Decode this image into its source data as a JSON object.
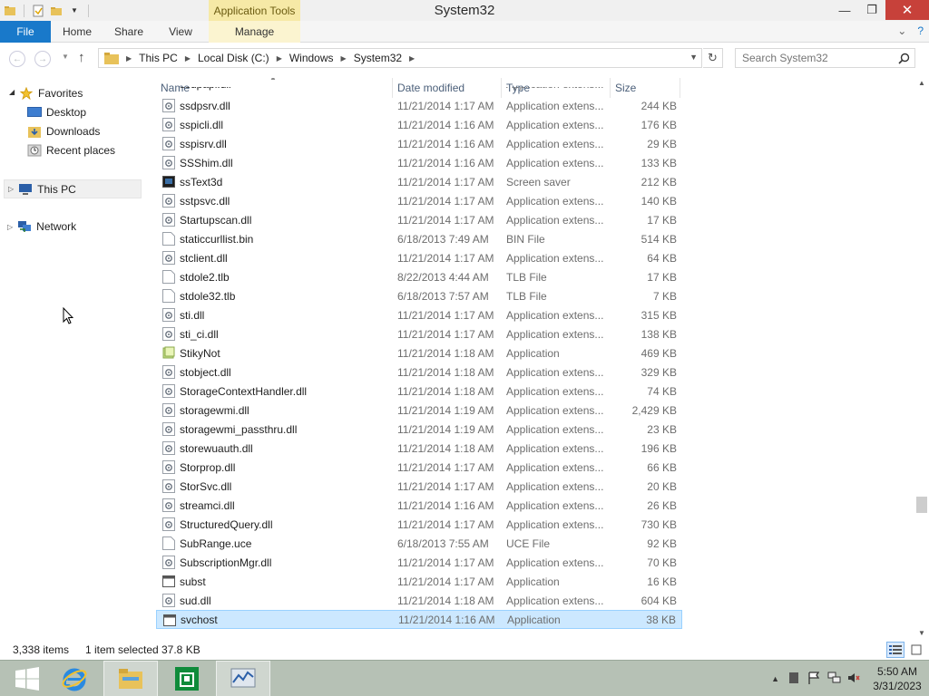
{
  "window": {
    "title": "System32",
    "contextual_tab": "Application Tools",
    "minimize": "—",
    "maximize": "❐",
    "close": "✕"
  },
  "ribbon": {
    "tabs": [
      "File",
      "Home",
      "Share",
      "View",
      "Manage"
    ],
    "expand": "⌄",
    "help": "?"
  },
  "address": {
    "crumbs": [
      "This PC",
      "Local Disk (C:)",
      "Windows",
      "System32"
    ],
    "search_placeholder": "Search System32"
  },
  "navpane": {
    "favorites": "Favorites",
    "desktop": "Desktop",
    "downloads": "Downloads",
    "recent": "Recent places",
    "this_pc": "This PC",
    "network": "Network"
  },
  "columns": {
    "name": "Name",
    "date": "Date modified",
    "type": "Type",
    "size": "Size"
  },
  "files": [
    {
      "name": "ssdpsrv.dll",
      "date": "11/21/2014 1:17 AM",
      "type": "Application extens...",
      "size": "244 KB",
      "icon": "dll"
    },
    {
      "name": "sspicli.dll",
      "date": "11/21/2014 1:16 AM",
      "type": "Application extens...",
      "size": "176 KB",
      "icon": "dll"
    },
    {
      "name": "sspisrv.dll",
      "date": "11/21/2014 1:16 AM",
      "type": "Application extens...",
      "size": "29 KB",
      "icon": "dll"
    },
    {
      "name": "SSShim.dll",
      "date": "11/21/2014 1:16 AM",
      "type": "Application extens...",
      "size": "133 KB",
      "icon": "dll"
    },
    {
      "name": "ssText3d",
      "date": "11/21/2014 1:17 AM",
      "type": "Screen saver",
      "size": "212 KB",
      "icon": "screensaver"
    },
    {
      "name": "sstpsvc.dll",
      "date": "11/21/2014 1:17 AM",
      "type": "Application extens...",
      "size": "140 KB",
      "icon": "dll"
    },
    {
      "name": "Startupscan.dll",
      "date": "11/21/2014 1:17 AM",
      "type": "Application extens...",
      "size": "17 KB",
      "icon": "dll"
    },
    {
      "name": "staticcurllist.bin",
      "date": "6/18/2013 7:49 AM",
      "type": "BIN File",
      "size": "514 KB",
      "icon": "blank"
    },
    {
      "name": "stclient.dll",
      "date": "11/21/2014 1:17 AM",
      "type": "Application extens...",
      "size": "64 KB",
      "icon": "dll"
    },
    {
      "name": "stdole2.tlb",
      "date": "8/22/2013 4:44 AM",
      "type": "TLB File",
      "size": "17 KB",
      "icon": "blank"
    },
    {
      "name": "stdole32.tlb",
      "date": "6/18/2013 7:57 AM",
      "type": "TLB File",
      "size": "7 KB",
      "icon": "blank"
    },
    {
      "name": "sti.dll",
      "date": "11/21/2014 1:17 AM",
      "type": "Application extens...",
      "size": "315 KB",
      "icon": "dll"
    },
    {
      "name": "sti_ci.dll",
      "date": "11/21/2014 1:17 AM",
      "type": "Application extens...",
      "size": "138 KB",
      "icon": "dll"
    },
    {
      "name": "StikyNot",
      "date": "11/21/2014 1:18 AM",
      "type": "Application",
      "size": "469 KB",
      "icon": "stikynot"
    },
    {
      "name": "stobject.dll",
      "date": "11/21/2014 1:18 AM",
      "type": "Application extens...",
      "size": "329 KB",
      "icon": "dll"
    },
    {
      "name": "StorageContextHandler.dll",
      "date": "11/21/2014 1:18 AM",
      "type": "Application extens...",
      "size": "74 KB",
      "icon": "dll"
    },
    {
      "name": "storagewmi.dll",
      "date": "11/21/2014 1:19 AM",
      "type": "Application extens...",
      "size": "2,429 KB",
      "icon": "dll"
    },
    {
      "name": "storagewmi_passthru.dll",
      "date": "11/21/2014 1:19 AM",
      "type": "Application extens...",
      "size": "23 KB",
      "icon": "dll"
    },
    {
      "name": "storewuauth.dll",
      "date": "11/21/2014 1:18 AM",
      "type": "Application extens...",
      "size": "196 KB",
      "icon": "dll"
    },
    {
      "name": "Storprop.dll",
      "date": "11/21/2014 1:17 AM",
      "type": "Application extens...",
      "size": "66 KB",
      "icon": "dll"
    },
    {
      "name": "StorSvc.dll",
      "date": "11/21/2014 1:17 AM",
      "type": "Application extens...",
      "size": "20 KB",
      "icon": "dll"
    },
    {
      "name": "streamci.dll",
      "date": "11/21/2014 1:16 AM",
      "type": "Application extens...",
      "size": "26 KB",
      "icon": "dll"
    },
    {
      "name": "StructuredQuery.dll",
      "date": "11/21/2014 1:17 AM",
      "type": "Application extens...",
      "size": "730 KB",
      "icon": "dll"
    },
    {
      "name": "SubRange.uce",
      "date": "6/18/2013 7:55 AM",
      "type": "UCE File",
      "size": "92 KB",
      "icon": "blank"
    },
    {
      "name": "SubscriptionMgr.dll",
      "date": "11/21/2014 1:17 AM",
      "type": "Application extens...",
      "size": "70 KB",
      "icon": "dll"
    },
    {
      "name": "subst",
      "date": "11/21/2014 1:17 AM",
      "type": "Application",
      "size": "16 KB",
      "icon": "app"
    },
    {
      "name": "sud.dll",
      "date": "11/21/2014 1:18 AM",
      "type": "Application extens...",
      "size": "604 KB",
      "icon": "dll"
    },
    {
      "name": "svchost",
      "date": "11/21/2014 1:16 AM",
      "type": "Application",
      "size": "38 KB",
      "icon": "app",
      "selected": true
    }
  ],
  "status": {
    "items": "3,338 items",
    "selected": "1 item selected",
    "selected_size": "37.8 KB"
  },
  "taskbar": {
    "time": "5:50 AM",
    "date": "3/31/2023"
  },
  "colors": {
    "accent": "#1979ca",
    "selection": "#cce8ff",
    "contextual": "#f6e9a6",
    "close": "#c7413a",
    "taskbar": "#b6c1b5"
  }
}
